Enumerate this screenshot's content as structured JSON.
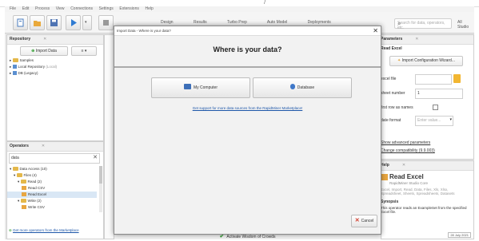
{
  "page_top": {
    "fragment": "/"
  },
  "menubar": {
    "items": [
      "File",
      "Edit",
      "Process",
      "View",
      "Connections",
      "Settings",
      "Extensions",
      "Help"
    ]
  },
  "toolbar": {
    "views": [
      "Design",
      "Results",
      "Turbo Prep",
      "Auto Model",
      "Deployments"
    ],
    "search_placeholder": "Search for data, operators, etc.",
    "studio_label": "All Studio"
  },
  "repository": {
    "title": "Repository",
    "import_button": "Import Data",
    "items": [
      "Samples",
      "Local Repository",
      "DB (Legacy)"
    ],
    "item_notes": [
      "",
      "(Local)",
      ""
    ]
  },
  "operators": {
    "title": "Operators",
    "search_value": "data",
    "tree": [
      {
        "label": "Data Access (10)",
        "level": 0,
        "icon": "folder-icon"
      },
      {
        "label": "Files (4)",
        "level": 1,
        "icon": "folder-icon"
      },
      {
        "label": "Read (2)",
        "level": 2,
        "icon": "folder-icon"
      },
      {
        "label": "Read CSV",
        "level": 3,
        "icon": "operator-icon"
      },
      {
        "label": "Read Excel",
        "level": 3,
        "icon": "operator-icon"
      },
      {
        "label": "Write (2)",
        "level": 2,
        "icon": "folder-icon"
      },
      {
        "label": "Write CSV",
        "level": 3,
        "icon": "operator-icon"
      }
    ],
    "selected_index": 4,
    "bottom_link": "Get more operators from the Marketplace"
  },
  "parameters": {
    "title": "Parameters",
    "operator": "Read Excel",
    "wizard_button": "Import Configuration Wizard...",
    "rows": [
      {
        "label": "excel file",
        "value": ""
      },
      {
        "label": "sheet number",
        "value": "1"
      },
      {
        "label": "first row as names",
        "value": ""
      },
      {
        "label": "date format",
        "value": "Enter value..."
      }
    ],
    "link_advanced": "Show advanced parameters",
    "link_compat": "Change compatibility (9.9.003)"
  },
  "help": {
    "title": "Help",
    "op_name": "Read Excel",
    "subtitle": "RapidMiner Studio Core",
    "tags": "Excel, Import, Read, Data, Files, Xls, Xlsx, Spreadsheet, Sheets, Spreadsheets, Datasets",
    "synopsis_head": "Synopsis",
    "synopsis": "This operator reads an ExampleSet from the specified Excel file.",
    "date": "28 July 2021"
  },
  "dialog": {
    "title": "Import Data - Where is your data?",
    "heading": "Where is your data?",
    "btn_computer": "My Computer",
    "btn_database": "Database",
    "link": "Get support for more data sources from the RapidMiner Marketplace!",
    "cancel": "Cancel"
  },
  "wisdom": {
    "label": "Activate Wisdom of Crowds"
  }
}
